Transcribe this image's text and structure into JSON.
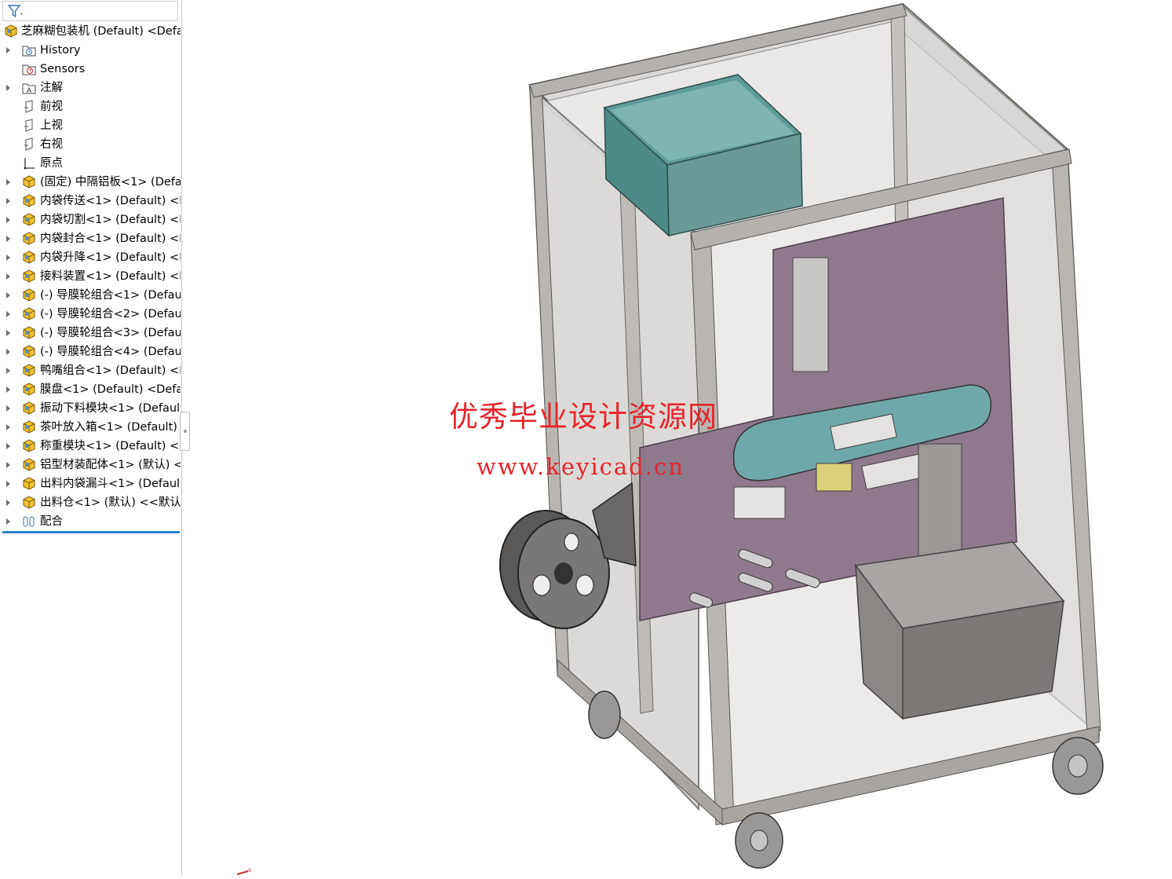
{
  "tree": {
    "root_label": "芝麻糊包装机 (Default) <Defa",
    "items": [
      {
        "label": "History",
        "icon": "history-folder-icon",
        "arrow": true,
        "kind": "folder"
      },
      {
        "label": "Sensors",
        "icon": "sensors-icon",
        "arrow": false,
        "kind": "sensor"
      },
      {
        "label": "注解",
        "icon": "annotations-icon",
        "arrow": true,
        "kind": "annot"
      },
      {
        "label": "前视",
        "icon": "plane-icon",
        "arrow": false,
        "kind": "plane"
      },
      {
        "label": "上视",
        "icon": "plane-icon",
        "arrow": false,
        "kind": "plane"
      },
      {
        "label": "右视",
        "icon": "plane-icon",
        "arrow": false,
        "kind": "plane"
      },
      {
        "label": "原点",
        "icon": "origin-icon",
        "arrow": false,
        "kind": "origin"
      },
      {
        "label": "(固定) 中隔铝板<1> (Defa",
        "icon": "part-icon",
        "arrow": true,
        "kind": "part"
      },
      {
        "label": "内袋传送<1> (Default) <D",
        "icon": "assembly-icon",
        "arrow": true,
        "kind": "asm"
      },
      {
        "label": "内袋切割<1> (Default) <D",
        "icon": "assembly-icon",
        "arrow": true,
        "kind": "asm"
      },
      {
        "label": "内袋封合<1> (Default) <D",
        "icon": "assembly-icon",
        "arrow": true,
        "kind": "asm"
      },
      {
        "label": "内袋升降<1> (Default) <D",
        "icon": "assembly-icon",
        "arrow": true,
        "kind": "asm"
      },
      {
        "label": "接料装置<1> (Default) <D",
        "icon": "assembly-icon",
        "arrow": true,
        "kind": "asm"
      },
      {
        "label": "(-) 导膜轮组合<1> (Defau",
        "icon": "assembly-icon",
        "arrow": true,
        "kind": "asm"
      },
      {
        "label": "(-) 导膜轮组合<2> (Defau",
        "icon": "assembly-icon",
        "arrow": true,
        "kind": "asm"
      },
      {
        "label": "(-) 导膜轮组合<3> (Defau",
        "icon": "assembly-icon",
        "arrow": true,
        "kind": "asm"
      },
      {
        "label": "(-) 导膜轮组合<4> (Defau",
        "icon": "assembly-icon",
        "arrow": true,
        "kind": "asm"
      },
      {
        "label": "鸭嘴组合<1> (Default) <D",
        "icon": "assembly-icon",
        "arrow": true,
        "kind": "asm"
      },
      {
        "label": "膜盘<1> (Default) <Defau",
        "icon": "assembly-icon",
        "arrow": true,
        "kind": "asm"
      },
      {
        "label": "振动下料模块<1> (Default",
        "icon": "assembly-icon",
        "arrow": true,
        "kind": "asm"
      },
      {
        "label": "茶叶放入箱<1> (Default)",
        "icon": "assembly-icon",
        "arrow": true,
        "kind": "asm"
      },
      {
        "label": "称重模块<1> (Default) <D",
        "icon": "assembly-icon",
        "arrow": true,
        "kind": "asm"
      },
      {
        "label": "铝型材装配体<1> (默认) <",
        "icon": "assembly-icon",
        "arrow": true,
        "kind": "asm"
      },
      {
        "label": "出料内袋漏斗<1> (Default",
        "icon": "part-icon",
        "arrow": true,
        "kind": "part"
      },
      {
        "label": "出料仓<1> (默认) <<默认",
        "icon": "part-icon",
        "arrow": true,
        "kind": "part"
      },
      {
        "label": "配合",
        "icon": "mates-icon",
        "arrow": true,
        "kind": "mates"
      }
    ]
  },
  "watermark": {
    "title": "优秀毕业设计资源网",
    "url": "www.keyicad.cn"
  },
  "colors": {
    "accent": "#2c7fd1",
    "watermark": "#e8232a",
    "frame": "#b9b6b2",
    "panel": "#8e7a8c",
    "hopper": "#5e9c98",
    "bin": "#8a8784"
  }
}
